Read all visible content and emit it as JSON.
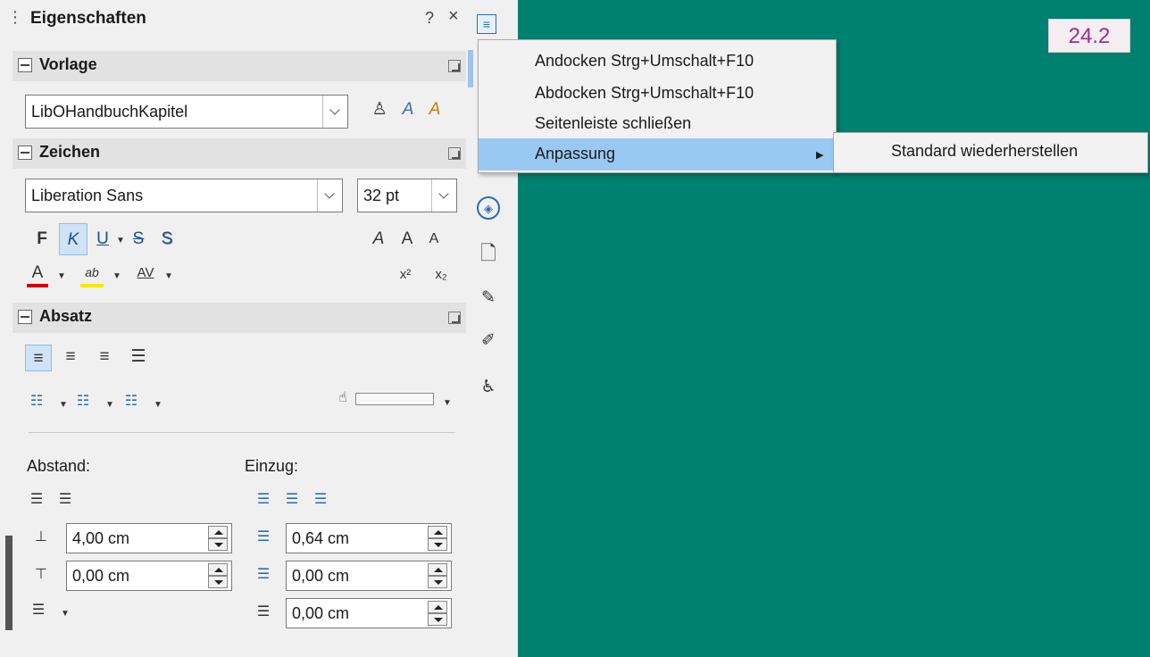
{
  "panel": {
    "title": "Eigenschaften",
    "help": "?",
    "close": "×"
  },
  "vorlage": {
    "header": "Vorlage",
    "style_value": "LibOHandbuchKapitel"
  },
  "zeichen": {
    "header": "Zeichen",
    "font_value": "Liberation Sans",
    "size_value": "32 pt",
    "bold": "F",
    "italic": "K",
    "underline": "U",
    "strike": "S",
    "shadow": "S",
    "font_color": "A",
    "spacing": "AV",
    "superscript": "x²",
    "subscript": "x₂"
  },
  "absatz": {
    "header": "Absatz",
    "abstand_label": "Abstand:",
    "einzug_label": "Einzug:",
    "above_value": "4,00 cm",
    "below_value": "0,00 cm",
    "indent_before_value": "0,64 cm",
    "indent_after_value": "0,00 cm",
    "first_line_value": "0,00 cm"
  },
  "menu": {
    "items": [
      {
        "label": "Andocken  Strg+Umschalt+F10"
      },
      {
        "label": "Abdocken  Strg+Umschalt+F10"
      },
      {
        "label": "Seitenleiste schließen"
      },
      {
        "label": "Anpassung"
      }
    ],
    "submenu_item": "Standard wiederherstellen"
  },
  "canvas": {
    "page_number": "24.2",
    "background": "#00806e"
  },
  "colors": {
    "menu_highlight": "#99c9f3",
    "font_color_bar": "#d40000",
    "highlight_bar": "#ffe600"
  }
}
